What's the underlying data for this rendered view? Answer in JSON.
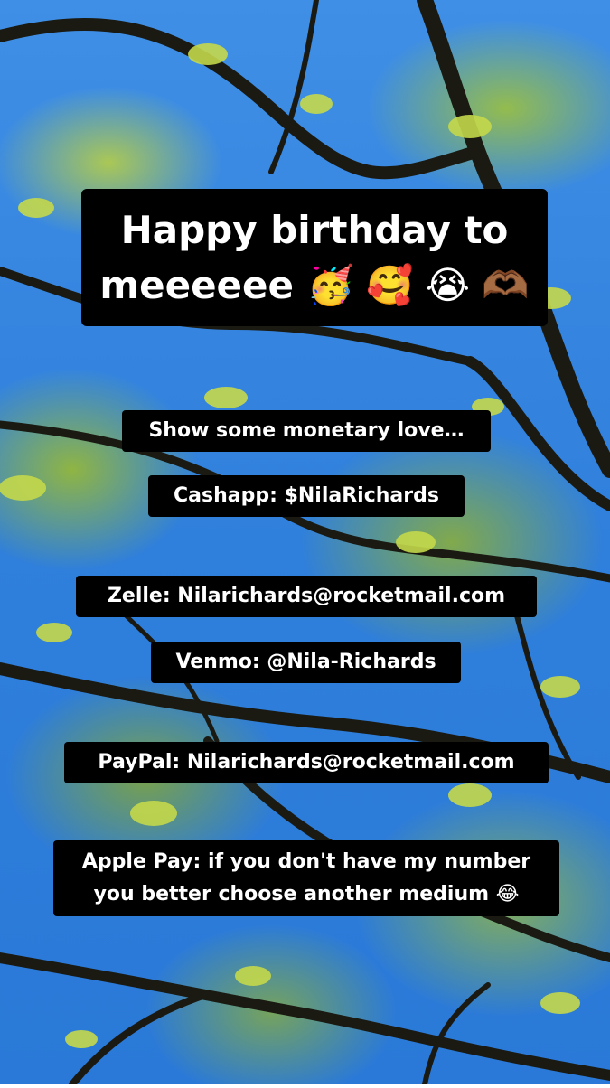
{
  "story": {
    "headline_line1": "Happy birthday to",
    "headline_line2": "meeeeee",
    "headline_emojis": "🥳 🥰 😭 🫶🏾",
    "intro": "Show some monetary love…",
    "cashapp": "Cashapp: $NilaRichards",
    "zelle": "Zelle: Nilarichards@rocketmail.com",
    "venmo": "Venmo: @Nila-Richards",
    "paypal": "PayPal: Nilarichards@rocketmail.com",
    "applepay_line1": "Apple Pay: if you don't have my number",
    "applepay_line2": "you better choose another medium",
    "applepay_emoji": "😂"
  },
  "background": {
    "description_icon": "tree-branches-background",
    "sky_color": "#2f7fdc",
    "leaf_color": "#b8d03a",
    "branch_color": "#1a1a12"
  }
}
